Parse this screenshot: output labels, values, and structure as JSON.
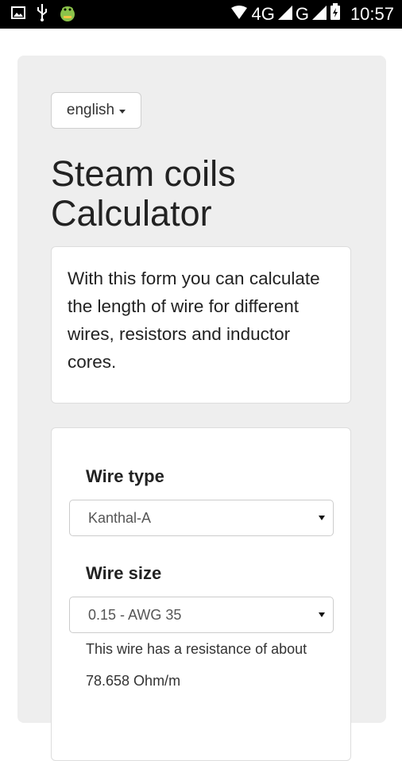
{
  "status_bar": {
    "network": "4G",
    "network2": "G",
    "time": "10:57"
  },
  "language_select": {
    "value": "english"
  },
  "page_title_line1": "Steam coils",
  "page_title_line2": "Calculator",
  "intro_text": "With this form you can calculate the length of wire for different wires, resistors and inductor cores.",
  "form": {
    "wire_type_label": "Wire type",
    "wire_type_value": "Kanthal-A",
    "wire_size_label": "Wire size",
    "wire_size_value": "0.15 - AWG 35",
    "resistance_line1": "This wire has a resistance of about",
    "resistance_line2": "78.658 Ohm/m"
  }
}
